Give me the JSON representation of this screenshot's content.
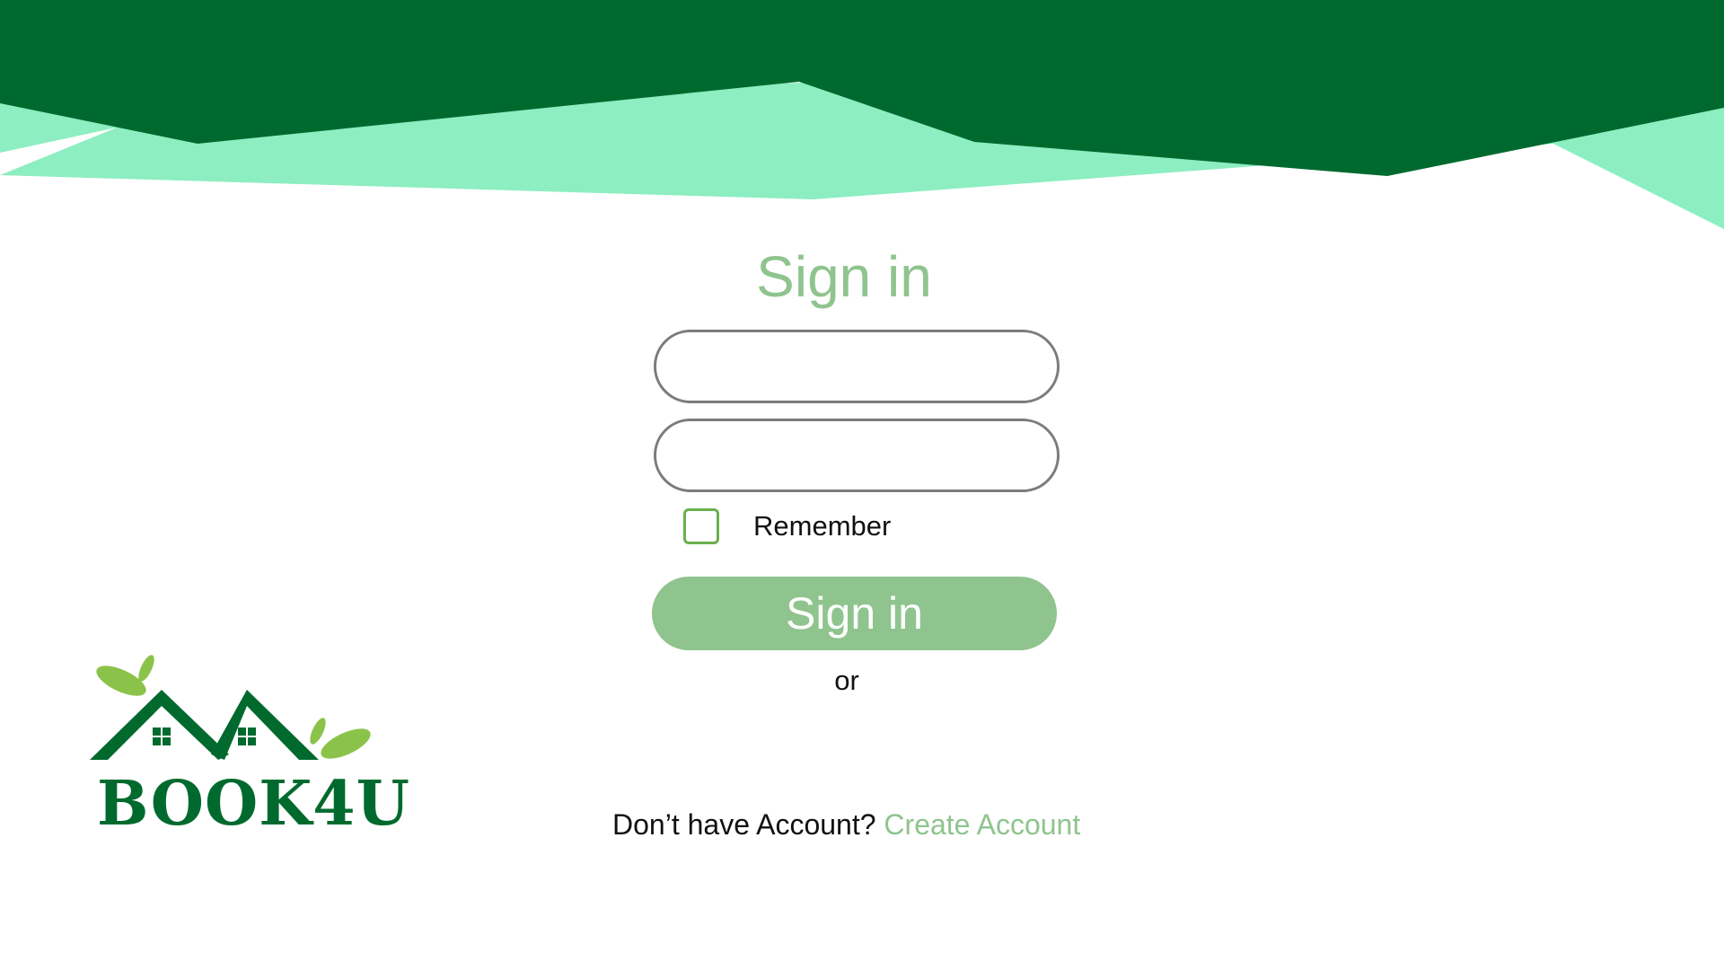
{
  "signin": {
    "title": "Sign in",
    "username_value": "",
    "password_value": "",
    "remember_label": "Remember",
    "remember_checked": false,
    "button_label": "Sign in",
    "or_text": "or",
    "no_account_text": "Don’t have Account?",
    "create_account_label": "Create Account"
  },
  "brand": {
    "name": "BOOK4U",
    "logo_icon": "houses-with-leaves-icon"
  },
  "colors": {
    "dark_green": "#006a2e",
    "mint": "#8ceec1",
    "accent_green": "#8fc48e",
    "checkbox_border": "#6ab04c",
    "leaf_green": "#8bc34a"
  }
}
